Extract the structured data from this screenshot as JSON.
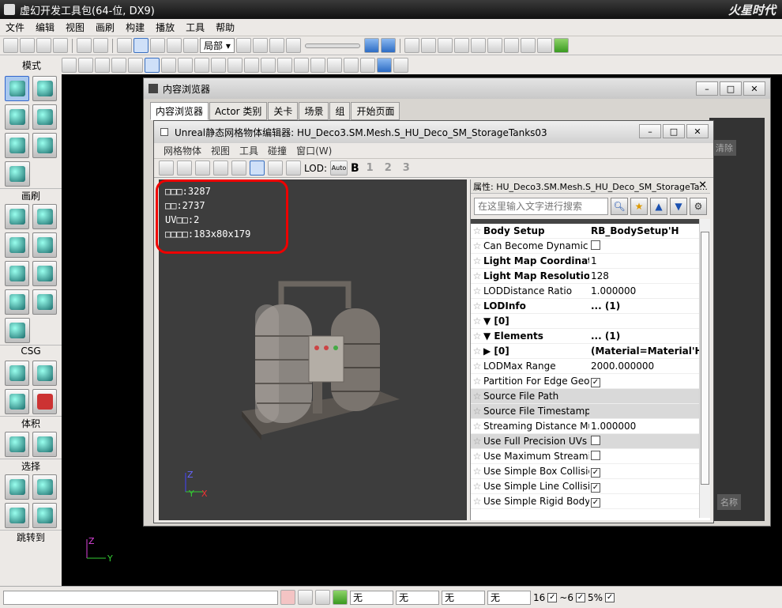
{
  "window": {
    "title": "虚幻开发工具包(64-位, DX9)",
    "watermark": "火星时代"
  },
  "menu": [
    "文件",
    "编辑",
    "视图",
    "画刷",
    "构建",
    "播放",
    "工具",
    "帮助"
  ],
  "toolbar": {
    "view_mode": "局部"
  },
  "left_panel": {
    "mode": "模式",
    "brush": "画刷",
    "csg": "CSG",
    "volume": "体积",
    "select": "选择",
    "goto": "跳转到"
  },
  "content_browser": {
    "title": "内容浏览器",
    "tabs": [
      "内容浏览器",
      "Actor 类别",
      "关卡",
      "场景",
      "组",
      "开始页面"
    ],
    "side_label": "清除",
    "side_label2": "名称"
  },
  "mesh_editor": {
    "title": "Unreal静态网格物体编辑器: HU_Deco3.SM.Mesh.S_HU_Deco_SM_StorageTanks03",
    "menu": [
      "网格物体",
      "视图",
      "工具",
      "碰撞",
      "窗口(W)"
    ],
    "lod_label": "LOD:",
    "lod_auto": "Auto",
    "lod_levels": [
      "B",
      "1",
      "2",
      "3"
    ],
    "stats": [
      "□□□:3287",
      "□□:2737",
      "UV□□:2",
      "□□□□:183x80x179"
    ],
    "axis": {
      "z": "Z",
      "y": "Y",
      "x": "X"
    }
  },
  "properties": {
    "header": "属性: HU_Deco3.SM.Mesh.S_HU_Deco_SM_StorageTa...",
    "search_placeholder": "在这里输入文字进行搜索",
    "rows": [
      {
        "name": "Body Setup",
        "value": "RB_BodySetup'H",
        "bold": true
      },
      {
        "name": "Can Become Dynamic",
        "value": "",
        "check": "off"
      },
      {
        "name": "Light Map Coordinate",
        "value": "1",
        "bold_name": true
      },
      {
        "name": "Light Map Resolution",
        "value": "128",
        "bold_name": true
      },
      {
        "name": "LODDistance Ratio",
        "value": "1.000000"
      },
      {
        "name": "LODInfo",
        "value": "... (1)",
        "bold": true
      },
      {
        "name": "▼ [0]",
        "value": "",
        "bold": true
      },
      {
        "name": "    ▼ Elements",
        "value": "... (1)",
        "bold": true
      },
      {
        "name": "         ▶ [0]",
        "value": "(Material=Material'HU",
        "bold": true
      },
      {
        "name": "LODMax Range",
        "value": "2000.000000"
      },
      {
        "name": "Partition For Edge Geom",
        "value": "",
        "check": "on"
      },
      {
        "name": "Source File Path",
        "value": "",
        "gray": true
      },
      {
        "name": "Source File Timestamp",
        "value": "",
        "gray": true
      },
      {
        "name": "Streaming Distance Mult",
        "value": "1.000000"
      },
      {
        "name": "Use Full Precision UVs",
        "value": "",
        "check": "off",
        "gray": true
      },
      {
        "name": "Use Maximum Streaming",
        "value": "",
        "check": "off"
      },
      {
        "name": "Use Simple Box Collision",
        "value": "",
        "check": "on"
      },
      {
        "name": "Use Simple Line Collision",
        "value": "",
        "check": "on"
      },
      {
        "name": "Use Simple Rigid Body C",
        "value": "",
        "check": "on"
      }
    ]
  },
  "axis_main": {
    "z": "Z",
    "y": "Y"
  },
  "status": {
    "fields": [
      "无",
      "无",
      "无",
      "无"
    ],
    "grid": "16",
    "angle": "~6",
    "pct": "5%"
  }
}
